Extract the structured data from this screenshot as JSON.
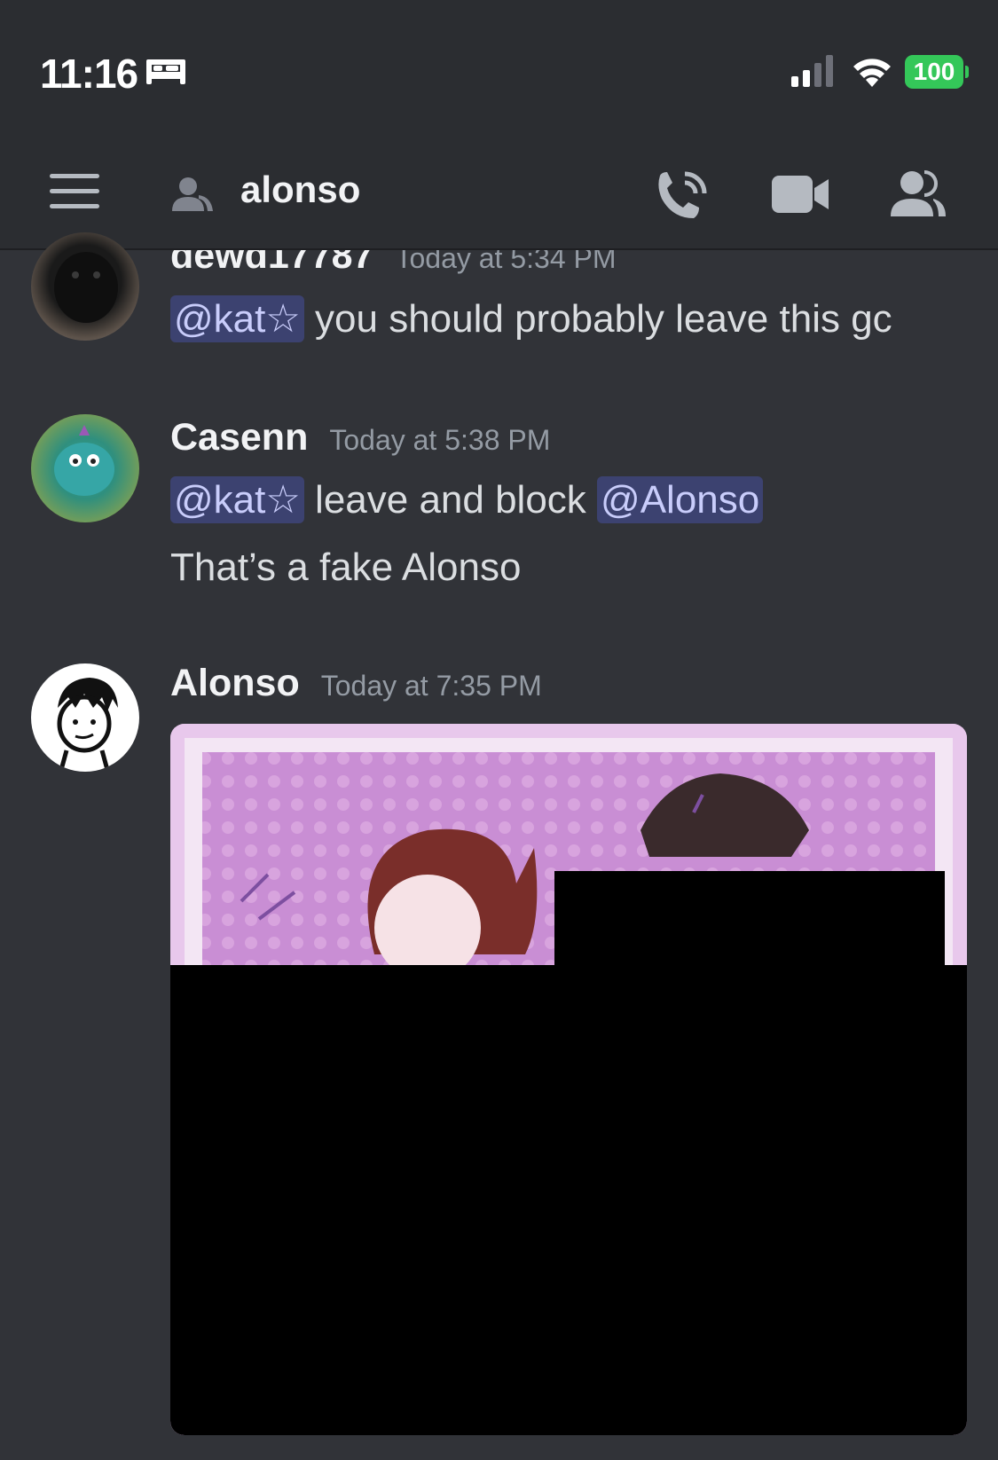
{
  "status_bar": {
    "time": "11:16",
    "battery": "100",
    "icons": [
      "bed-icon",
      "cellular-signal-icon",
      "wifi-icon",
      "battery-icon"
    ]
  },
  "header": {
    "channel_name": "alonso",
    "icons": [
      "hamburger-menu-icon",
      "dm-user-icon",
      "voice-call-icon",
      "video-call-icon",
      "members-icon"
    ]
  },
  "messages": [
    {
      "username": "dewd17787",
      "timestamp": "Today at 5:34 PM",
      "lines": [
        {
          "mention": "@kat☆",
          "text": " you should probably leave this gc"
        }
      ]
    },
    {
      "username": "Casenn",
      "timestamp": "Today at 5:38 PM",
      "lines": [
        {
          "mention": "@kat☆",
          "text": " leave and block ",
          "mention2": "@Alonso"
        },
        {
          "text": "That’s a fake Alonso"
        }
      ]
    },
    {
      "username": "Alonso",
      "timestamp": "Today at 7:35 PM",
      "attachment": "image"
    }
  ],
  "colors": {
    "background": "#313338",
    "header": "#2b2d31",
    "mention_bg": "#3c4270",
    "mention_text": "#c9cdfb",
    "battery": "#34c759"
  }
}
